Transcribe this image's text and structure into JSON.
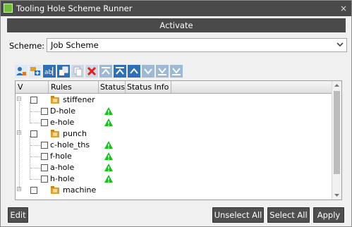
{
  "window": {
    "title": "Tooling Hole Scheme Runner",
    "close_glyph": "×"
  },
  "activate": {
    "label": "Activate"
  },
  "scheme": {
    "label": "Scheme:",
    "value": "Job Scheme"
  },
  "toolbar": {
    "icons": [
      "person-tree-icon",
      "tree-add-icon",
      "rename-icon",
      "paste-icon",
      "copy-icon",
      "delete-icon",
      "move-top-icon",
      "move-top-dark-icon",
      "move-up-icon",
      "move-down-icon",
      "move-bottom-light-icon",
      "move-bottom-icon"
    ]
  },
  "tree": {
    "columns": {
      "v": "V",
      "rules": "Rules",
      "status": "Status",
      "status_info": "Status Info"
    },
    "groups": [
      {
        "name": "stiffener",
        "children": [
          {
            "name": "D-hole",
            "status": "ok"
          },
          {
            "name": "e-hole",
            "status": "ok"
          }
        ]
      },
      {
        "name": "punch",
        "children": [
          {
            "name": "c-hole_ths",
            "status": "ok"
          },
          {
            "name": "f-hole",
            "status": "ok"
          },
          {
            "name": "a-hole",
            "status": "ok"
          },
          {
            "name": "h-hole",
            "status": "ok"
          }
        ]
      },
      {
        "name": "machine",
        "children": []
      }
    ],
    "collapse_glyph": "⊟"
  },
  "buttons": {
    "edit": "Edit",
    "unselect_all": "Unselect All",
    "select_all": "Select All",
    "apply": "Apply"
  },
  "colors": {
    "title_bg": "#4a4a4a",
    "status_ok": "#19c219",
    "accent_red": "#e02020",
    "tool_blue": "#2f6fb8"
  }
}
